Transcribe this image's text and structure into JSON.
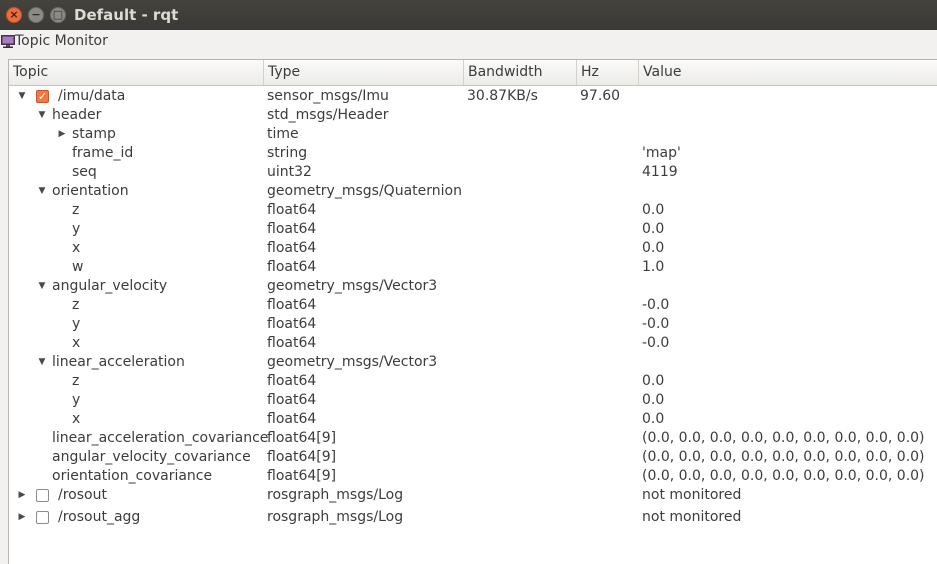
{
  "window": {
    "title": "Default - rqt",
    "close_glyph": "×",
    "min_glyph": "−",
    "max_glyph": "□"
  },
  "plugin": {
    "title": "Topic Monitor",
    "icon": "monitor-icon"
  },
  "columns": [
    "Topic",
    "Type",
    "Bandwidth",
    "Hz",
    "Value"
  ],
  "rows": [
    {
      "depth": 0,
      "expander": "expanded",
      "checkbox": "checked",
      "topic": "/imu/data",
      "type": "sensor_msgs/Imu",
      "bandwidth": "30.87KB/s",
      "hz": "97.60",
      "value": ""
    },
    {
      "depth": 1,
      "expander": "expanded",
      "checkbox": "none",
      "topic": "header",
      "type": "std_msgs/Header",
      "bandwidth": "",
      "hz": "",
      "value": ""
    },
    {
      "depth": 2,
      "expander": "collapsed",
      "checkbox": "none",
      "topic": "stamp",
      "type": "time",
      "bandwidth": "",
      "hz": "",
      "value": ""
    },
    {
      "depth": 2,
      "expander": "none",
      "checkbox": "none",
      "topic": "frame_id",
      "type": "string",
      "bandwidth": "",
      "hz": "",
      "value": "'map'"
    },
    {
      "depth": 2,
      "expander": "none",
      "checkbox": "none",
      "topic": "seq",
      "type": "uint32",
      "bandwidth": "",
      "hz": "",
      "value": "4119"
    },
    {
      "depth": 1,
      "expander": "expanded",
      "checkbox": "none",
      "topic": "orientation",
      "type": "geometry_msgs/Quaternion",
      "bandwidth": "",
      "hz": "",
      "value": ""
    },
    {
      "depth": 2,
      "expander": "none",
      "checkbox": "none",
      "topic": "z",
      "type": "float64",
      "bandwidth": "",
      "hz": "",
      "value": "0.0"
    },
    {
      "depth": 2,
      "expander": "none",
      "checkbox": "none",
      "topic": "y",
      "type": "float64",
      "bandwidth": "",
      "hz": "",
      "value": "0.0"
    },
    {
      "depth": 2,
      "expander": "none",
      "checkbox": "none",
      "topic": "x",
      "type": "float64",
      "bandwidth": "",
      "hz": "",
      "value": "0.0"
    },
    {
      "depth": 2,
      "expander": "none",
      "checkbox": "none",
      "topic": "w",
      "type": "float64",
      "bandwidth": "",
      "hz": "",
      "value": "1.0"
    },
    {
      "depth": 1,
      "expander": "expanded",
      "checkbox": "none",
      "topic": "angular_velocity",
      "type": "geometry_msgs/Vector3",
      "bandwidth": "",
      "hz": "",
      "value": ""
    },
    {
      "depth": 2,
      "expander": "none",
      "checkbox": "none",
      "topic": "z",
      "type": "float64",
      "bandwidth": "",
      "hz": "",
      "value": "-0.0"
    },
    {
      "depth": 2,
      "expander": "none",
      "checkbox": "none",
      "topic": "y",
      "type": "float64",
      "bandwidth": "",
      "hz": "",
      "value": "-0.0"
    },
    {
      "depth": 2,
      "expander": "none",
      "checkbox": "none",
      "topic": "x",
      "type": "float64",
      "bandwidth": "",
      "hz": "",
      "value": "-0.0"
    },
    {
      "depth": 1,
      "expander": "expanded",
      "checkbox": "none",
      "topic": "linear_acceleration",
      "type": "geometry_msgs/Vector3",
      "bandwidth": "",
      "hz": "",
      "value": ""
    },
    {
      "depth": 2,
      "expander": "none",
      "checkbox": "none",
      "topic": "z",
      "type": "float64",
      "bandwidth": "",
      "hz": "",
      "value": "0.0"
    },
    {
      "depth": 2,
      "expander": "none",
      "checkbox": "none",
      "topic": "y",
      "type": "float64",
      "bandwidth": "",
      "hz": "",
      "value": "0.0"
    },
    {
      "depth": 2,
      "expander": "none",
      "checkbox": "none",
      "topic": "x",
      "type": "float64",
      "bandwidth": "",
      "hz": "",
      "value": "0.0"
    },
    {
      "depth": 1,
      "expander": "none",
      "checkbox": "none",
      "topic": "linear_acceleration_covariance",
      "type": "float64[9]",
      "bandwidth": "",
      "hz": "",
      "value": "(0.0, 0.0, 0.0, 0.0, 0.0, 0.0, 0.0, 0.0, 0.0)"
    },
    {
      "depth": 1,
      "expander": "none",
      "checkbox": "none",
      "topic": "angular_velocity_covariance",
      "type": "float64[9]",
      "bandwidth": "",
      "hz": "",
      "value": "(0.0, 0.0, 0.0, 0.0, 0.0, 0.0, 0.0, 0.0, 0.0)"
    },
    {
      "depth": 1,
      "expander": "none",
      "checkbox": "none",
      "topic": "orientation_covariance",
      "type": "float64[9]",
      "bandwidth": "",
      "hz": "",
      "value": "(0.0, 0.0, 0.0, 0.0, 0.0, 0.0, 0.0, 0.0, 0.0)"
    },
    {
      "depth": 0,
      "expander": "collapsed",
      "checkbox": "unchecked",
      "topic": "/rosout",
      "type": "rosgraph_msgs/Log",
      "bandwidth": "",
      "hz": "",
      "value": "not monitored"
    },
    {
      "depth": 0,
      "expander": "collapsed",
      "checkbox": "unchecked",
      "topic": "/rosout_agg",
      "type": "rosgraph_msgs/Log",
      "bandwidth": "",
      "hz": "",
      "value": "not monitored"
    }
  ],
  "glyphs": {
    "expanded": "▼",
    "collapsed": "▶",
    "check": "✓"
  },
  "colors": {
    "titlebar": "#3c3b37",
    "close_button": "#ee6b3c",
    "checkbox_checked": "#f07746"
  }
}
